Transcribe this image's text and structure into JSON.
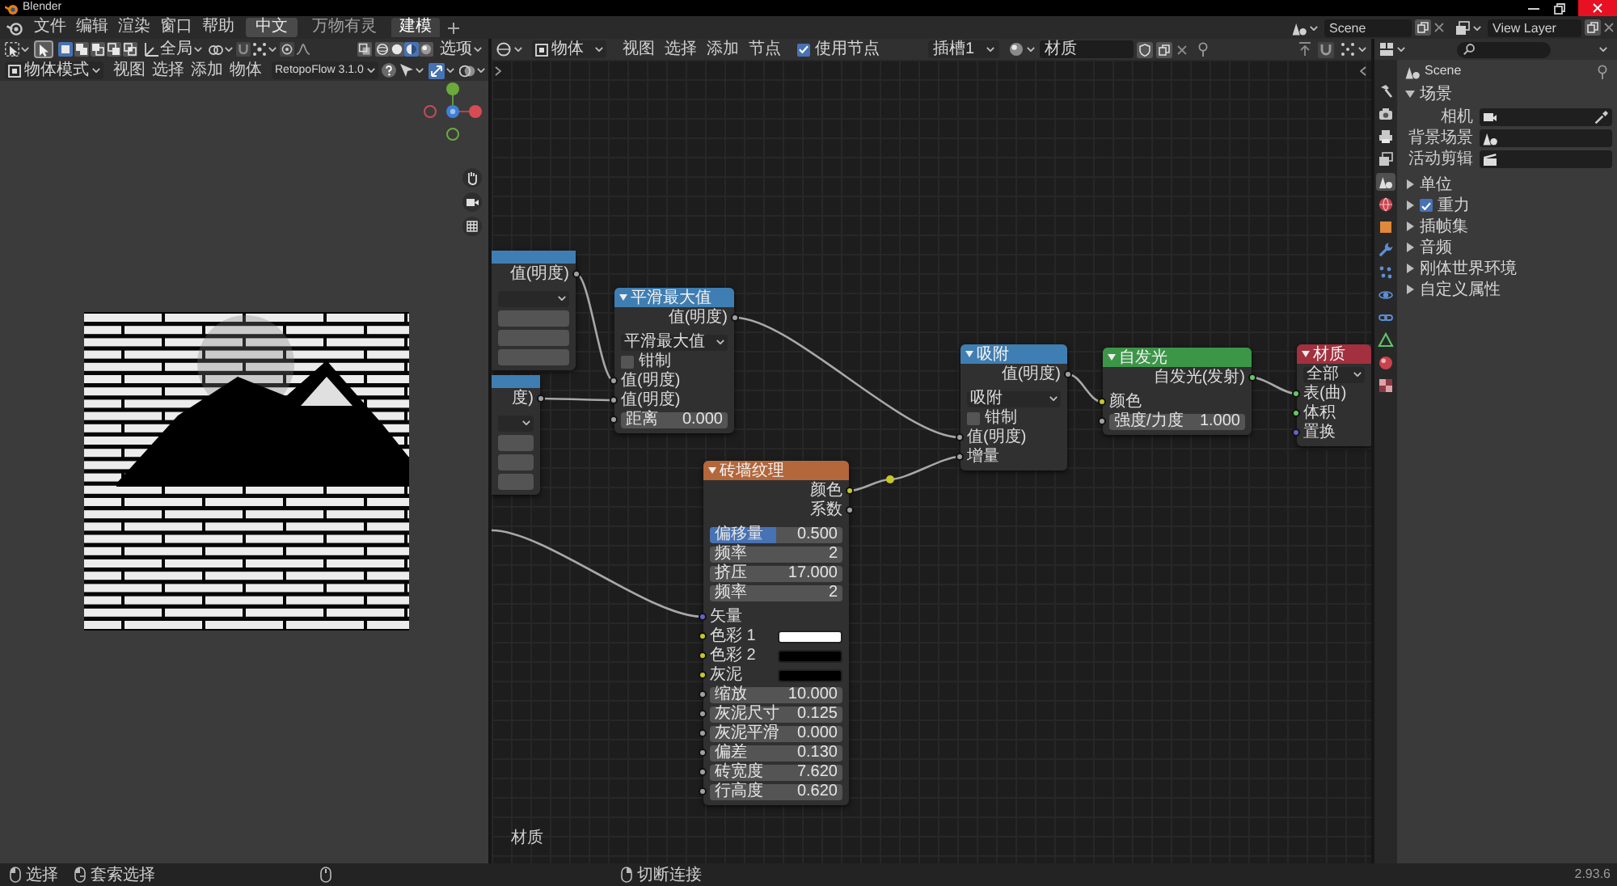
{
  "window": {
    "title": "Blender"
  },
  "top_bar": {
    "menus": [
      "文件",
      "编辑",
      "渲染",
      "窗口",
      "帮助"
    ],
    "language_button": "中文",
    "workspaces": [
      {
        "label": "万物有灵",
        "selected": false
      },
      {
        "label": "建模",
        "selected": true
      }
    ],
    "scene": "Scene",
    "view_layer": "View Layer"
  },
  "viewport": {
    "select_modes": [
      {
        "kind": "set",
        "selected": true
      },
      {
        "kind": "extend",
        "selected": false
      },
      {
        "kind": "subtract",
        "selected": false
      },
      {
        "kind": "difference",
        "selected": false
      },
      {
        "kind": "intersect",
        "selected": false
      }
    ],
    "orientation": "全局",
    "shading_modes": [
      {
        "kind": "wireframe",
        "selected": false
      },
      {
        "kind": "solid",
        "selected": false
      },
      {
        "kind": "material",
        "selected": true
      },
      {
        "kind": "rendered",
        "selected": false
      }
    ],
    "options": "选项",
    "mode": "物体模式",
    "menus": [
      "视图",
      "选择",
      "添加",
      "物体"
    ],
    "addon": "RetopoFlow 3.1.0"
  },
  "node_editor": {
    "object_type": "物体",
    "menus": [
      "视图",
      "选择",
      "添加",
      "节点"
    ],
    "use_nodes": {
      "label": "使用节点",
      "checked": true
    },
    "slot": "插槽1",
    "material": "材质",
    "nodes": [
      {
        "kind": "converter",
        "rows": [
          {
            "kind": "output",
            "label": "值(明度)",
            "socket": {
              "kind": "value"
            }
          },
          {
            "kind": "dropdown"
          },
          {
            "kind": "field"
          },
          {
            "kind": "field"
          },
          {
            "kind": "field"
          }
        ]
      },
      {
        "kind": "converter",
        "rows": [
          {
            "kind": "output",
            "label": "度)",
            "socket": {
              "kind": "value"
            }
          },
          {
            "kind": "dropdown"
          },
          {
            "kind": "field"
          },
          {
            "kind": "field"
          },
          {
            "kind": "field"
          }
        ]
      },
      {
        "kind": "converter",
        "title": "平滑最大值",
        "rows": [
          {
            "kind": "output",
            "label": "值(明度)",
            "socket": {
              "kind": "value"
            }
          },
          {
            "kind": "dropdown",
            "value": "平滑最大值"
          },
          {
            "kind": "checkbox",
            "label": "钳制",
            "checked": false
          },
          {
            "kind": "input",
            "label": "值(明度)",
            "socket": {
              "kind": "value"
            }
          },
          {
            "kind": "input",
            "label": "值(明度)",
            "socket": {
              "kind": "value"
            }
          },
          {
            "kind": "field",
            "label": "距离",
            "value": "0.000",
            "socket": {
              "kind": "value"
            }
          }
        ]
      },
      {
        "kind": "converter",
        "title": "吸附",
        "rows": [
          {
            "kind": "output",
            "label": "值(明度)",
            "socket": {
              "kind": "value"
            }
          },
          {
            "kind": "dropdown",
            "value": "吸附"
          },
          {
            "kind": "checkbox",
            "label": "钳制",
            "checked": false
          },
          {
            "kind": "input",
            "label": "值(明度)",
            "socket": {
              "kind": "value"
            }
          },
          {
            "kind": "input",
            "label": "增量",
            "socket": {
              "kind": "value"
            }
          }
        ]
      },
      {
        "kind": "shader",
        "title": "自发光",
        "rows": [
          {
            "kind": "output",
            "label": "自发光(发射)",
            "socket": {
              "kind": "shader"
            }
          },
          {
            "kind": "input",
            "label": "颜色",
            "socket": {
              "kind": "color"
            }
          },
          {
            "kind": "field",
            "label": "强度/力度",
            "value": "1.000",
            "socket": {
              "kind": "value"
            }
          }
        ]
      },
      {
        "kind": "output",
        "title": "材质",
        "rows": [
          {
            "kind": "dropdown",
            "value": "全部"
          },
          {
            "kind": "input",
            "label": "表(曲)",
            "socket": {
              "kind": "shader"
            }
          },
          {
            "kind": "input",
            "label": "体积",
            "socket": {
              "kind": "shader"
            }
          },
          {
            "kind": "input",
            "label": "置换",
            "socket": {
              "kind": "vector"
            }
          }
        ]
      },
      {
        "kind": "texture",
        "title": "砖墙纹理",
        "rows": [
          {
            "kind": "output",
            "label": "颜色",
            "socket": {
              "kind": "color"
            }
          },
          {
            "kind": "output",
            "label": "系数",
            "socket": {
              "kind": "value"
            }
          },
          {
            "kind": "slider",
            "label": "偏移量",
            "value": "0.500",
            "level": 0.5
          },
          {
            "kind": "field",
            "label": "频率",
            "value": "2"
          },
          {
            "kind": "field",
            "label": "挤压",
            "value": "17.000"
          },
          {
            "kind": "field",
            "label": "频率",
            "value": "2"
          },
          {
            "kind": "input",
            "label": "矢量",
            "socket": {
              "kind": "vector"
            }
          },
          {
            "kind": "color",
            "label": "色彩 1",
            "color": "#ffffff",
            "socket": {
              "kind": "color"
            }
          },
          {
            "kind": "color",
            "label": "色彩 2",
            "color": "#000000",
            "socket": {
              "kind": "color"
            }
          },
          {
            "kind": "color",
            "label": "灰泥",
            "color": "#000000",
            "socket": {
              "kind": "color"
            }
          },
          {
            "kind": "field",
            "label": "缩放",
            "value": "10.000",
            "socket": {
              "kind": "value"
            }
          },
          {
            "kind": "field",
            "label": "灰泥尺寸",
            "value": "0.125",
            "socket": {
              "kind": "value"
            }
          },
          {
            "kind": "field",
            "label": "灰泥平滑",
            "value": "0.000",
            "socket": {
              "kind": "value"
            }
          },
          {
            "kind": "field",
            "label": "偏差",
            "value": "0.130",
            "socket": {
              "kind": "value"
            }
          },
          {
            "kind": "field",
            "label": "砖宽度",
            "value": "7.620",
            "socket": {
              "kind": "value"
            }
          },
          {
            "kind": "field",
            "label": "行高度",
            "value": "0.620",
            "socket": {
              "kind": "value"
            }
          }
        ]
      },
      {
        "kind": "reroute"
      }
    ],
    "tree_label": "材质"
  },
  "properties": {
    "tabs": [
      {
        "kind": "tool",
        "selected": false
      },
      {
        "kind": "render",
        "selected": false
      },
      {
        "kind": "output",
        "selected": false
      },
      {
        "kind": "view_layer",
        "selected": false
      },
      {
        "kind": "scene",
        "selected": true
      },
      {
        "kind": "world",
        "selected": false
      },
      {
        "kind": "object",
        "selected": false
      },
      {
        "kind": "modifiers",
        "selected": false
      },
      {
        "kind": "particles",
        "selected": false
      },
      {
        "kind": "physics",
        "selected": false
      },
      {
        "kind": "constraints",
        "selected": false
      },
      {
        "kind": "data",
        "selected": false
      },
      {
        "kind": "material",
        "selected": false
      },
      {
        "kind": "texture",
        "selected": false
      }
    ],
    "context": "Scene",
    "sections": [
      {
        "title": "场景",
        "kind": "panel",
        "expanded": true,
        "fields": [
          {
            "label": "相机",
            "kind": "camera"
          },
          {
            "label": "背景场景",
            "kind": "scene"
          },
          {
            "label": "活动剪辑",
            "kind": "clip"
          }
        ]
      },
      {
        "title": "单位",
        "kind": "panel",
        "expanded": false
      },
      {
        "title": "重力",
        "kind": "toggle",
        "expanded": false,
        "checked": true
      },
      {
        "title": "插帧集",
        "kind": "panel",
        "expanded": false
      },
      {
        "title": "音频",
        "kind": "panel",
        "expanded": false
      },
      {
        "title": "刚体世界环境",
        "kind": "panel",
        "expanded": false
      },
      {
        "title": "自定义属性",
        "kind": "panel",
        "expanded": false
      }
    ]
  },
  "status_bar": {
    "hints": [
      {
        "kind": "left_mouse",
        "label": "选择"
      },
      {
        "kind": "left_drag",
        "label": "套索选择"
      },
      {
        "kind": "middle_mouse"
      },
      {
        "kind": "right_mouse",
        "label": "切断连接"
      }
    ],
    "version": "2.93.6"
  }
}
